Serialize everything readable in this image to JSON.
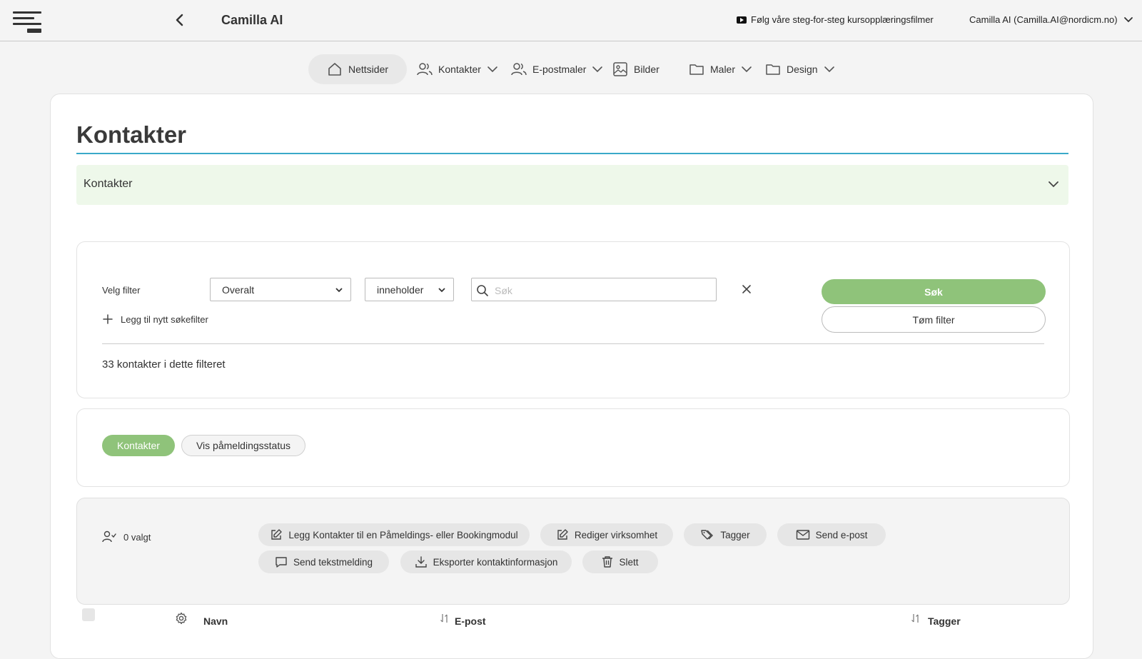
{
  "header": {
    "title": "Camilla AI",
    "tutorial_link": "Følg våre steg-for-steg kursopplæringsfilmer",
    "user_label": "Camilla AI (Camilla.AI@nordicm.no)"
  },
  "nav": {
    "items": [
      {
        "label": "Nettsider",
        "icon": "home-icon",
        "active": true
      },
      {
        "label": "Kontakter",
        "icon": "users-icon",
        "dropdown": true
      },
      {
        "label": "E-postmaler",
        "icon": "users-icon",
        "dropdown": true
      },
      {
        "label": "Bilder",
        "icon": "image-icon"
      },
      {
        "label": "Maler",
        "icon": "folder-icon",
        "dropdown": true
      },
      {
        "label": "Design",
        "icon": "folder-icon",
        "dropdown": true
      }
    ]
  },
  "page": {
    "title": "Kontakter",
    "accordion_label": "Kontakter"
  },
  "filter": {
    "label": "Velg filter",
    "field_value": "Overalt",
    "operator_value": "inneholder",
    "search_placeholder": "Søk",
    "add_filter_label": "Legg til nytt søkefilter",
    "search_button": "Søk",
    "clear_button": "Tøm filter",
    "count_text": "33 kontakter i dette filteret"
  },
  "tabs": {
    "contacts": "Kontakter",
    "show_status": "Vis påmeldingsstatus"
  },
  "actions": {
    "selected_label": "0 valgt",
    "add_to_module": "Legg Kontakter til en Påmeldings- eller Bookingmodul",
    "edit_company": "Rediger virksomhet",
    "tags": "Tagger",
    "send_email": "Send e-post",
    "send_sms": "Send tekstmelding",
    "export": "Eksporter kontaktinformasjon",
    "delete": "Slett"
  },
  "table": {
    "columns": [
      "Navn",
      "E-post",
      "Tagger"
    ]
  },
  "colors": {
    "accent_green": "#8fc37a",
    "accent_blue_line": "#3aa9c9",
    "accordion_bg": "#eef8ea"
  }
}
